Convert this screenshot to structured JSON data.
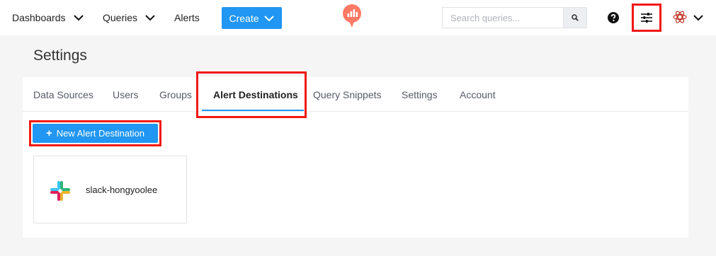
{
  "nav": {
    "dashboards": "Dashboards",
    "queries": "Queries",
    "alerts": "Alerts",
    "create": "Create",
    "search_placeholder": "Search queries..."
  },
  "page_title": "Settings",
  "tabs": [
    {
      "label": "Data Sources"
    },
    {
      "label": "Users"
    },
    {
      "label": "Groups"
    },
    {
      "label": "Alert Destinations",
      "active": true
    },
    {
      "label": "Query Snippets"
    },
    {
      "label": "Settings"
    },
    {
      "label": "Account"
    }
  ],
  "new_button": {
    "label": "New Alert Destination",
    "icon": "plus-icon"
  },
  "destinations": [
    {
      "name": "slack-hongyoolee",
      "icon": "slack-icon"
    }
  ],
  "colors": {
    "accent": "#2196f3",
    "highlight": "#f0190f",
    "logo": "#ff7964"
  }
}
